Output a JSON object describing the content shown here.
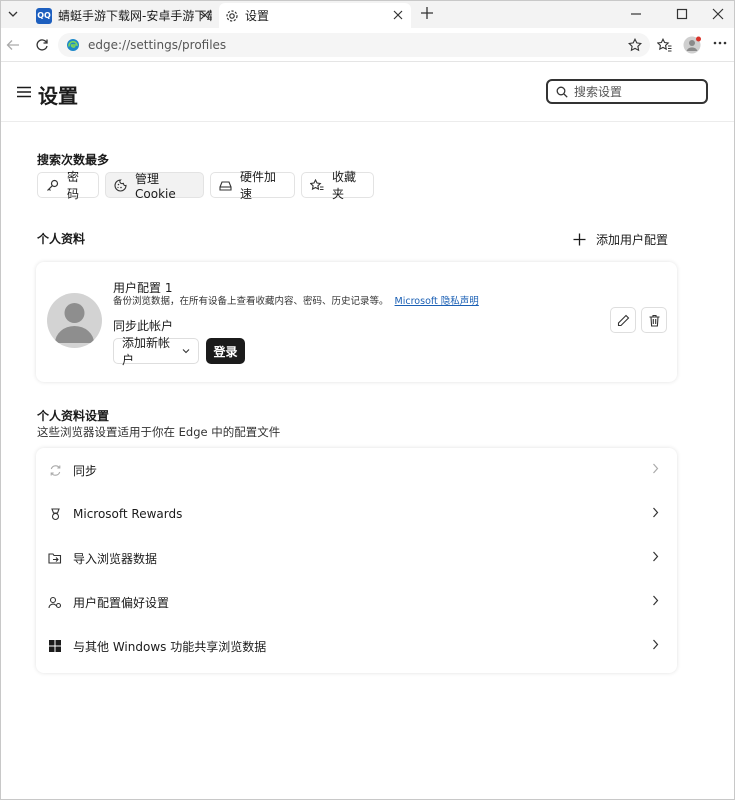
{
  "tabs": [
    {
      "label": "蜻蜓手游下载网-安卓手游下载站-手",
      "favicon_text": "QQ"
    },
    {
      "label": "设置"
    }
  ],
  "address": {
    "url": "edge://settings/profiles"
  },
  "settings": {
    "title": "设置",
    "search_placeholder": "搜索设置"
  },
  "most_searched": {
    "label": "搜索次数最多",
    "chips": [
      "密码",
      "管理 Cookie",
      "硬件加速",
      "收藏夹"
    ]
  },
  "profiles": {
    "label": "个人资料",
    "add_profile": "添加用户配置",
    "card": {
      "name": "用户配置 1",
      "description": "备份浏览数据，在所有设备上查看收藏内容、密码、历史记录等。",
      "privacy_link": "Microsoft 隐私声明",
      "sync_label": "同步此帐户",
      "add_account": "添加新帐户",
      "sign_in": "登录"
    }
  },
  "profile_settings": {
    "label": "个人资料设置",
    "subtitle": "这些浏览器设置适用于你在 Edge 中的配置文件",
    "items": [
      {
        "label": "同步",
        "icon": "sync-icon"
      },
      {
        "label": "Microsoft Rewards",
        "icon": "rewards-icon"
      },
      {
        "label": "导入浏览器数据",
        "icon": "import-icon"
      },
      {
        "label": "用户配置偏好设置",
        "icon": "profile-prefs-icon"
      },
      {
        "label": "与其他 Windows 功能共享浏览数据",
        "icon": "windows-icon"
      }
    ]
  },
  "colors": {
    "accent": "#1a5fb4",
    "dark_button": "#1b1b1b"
  }
}
